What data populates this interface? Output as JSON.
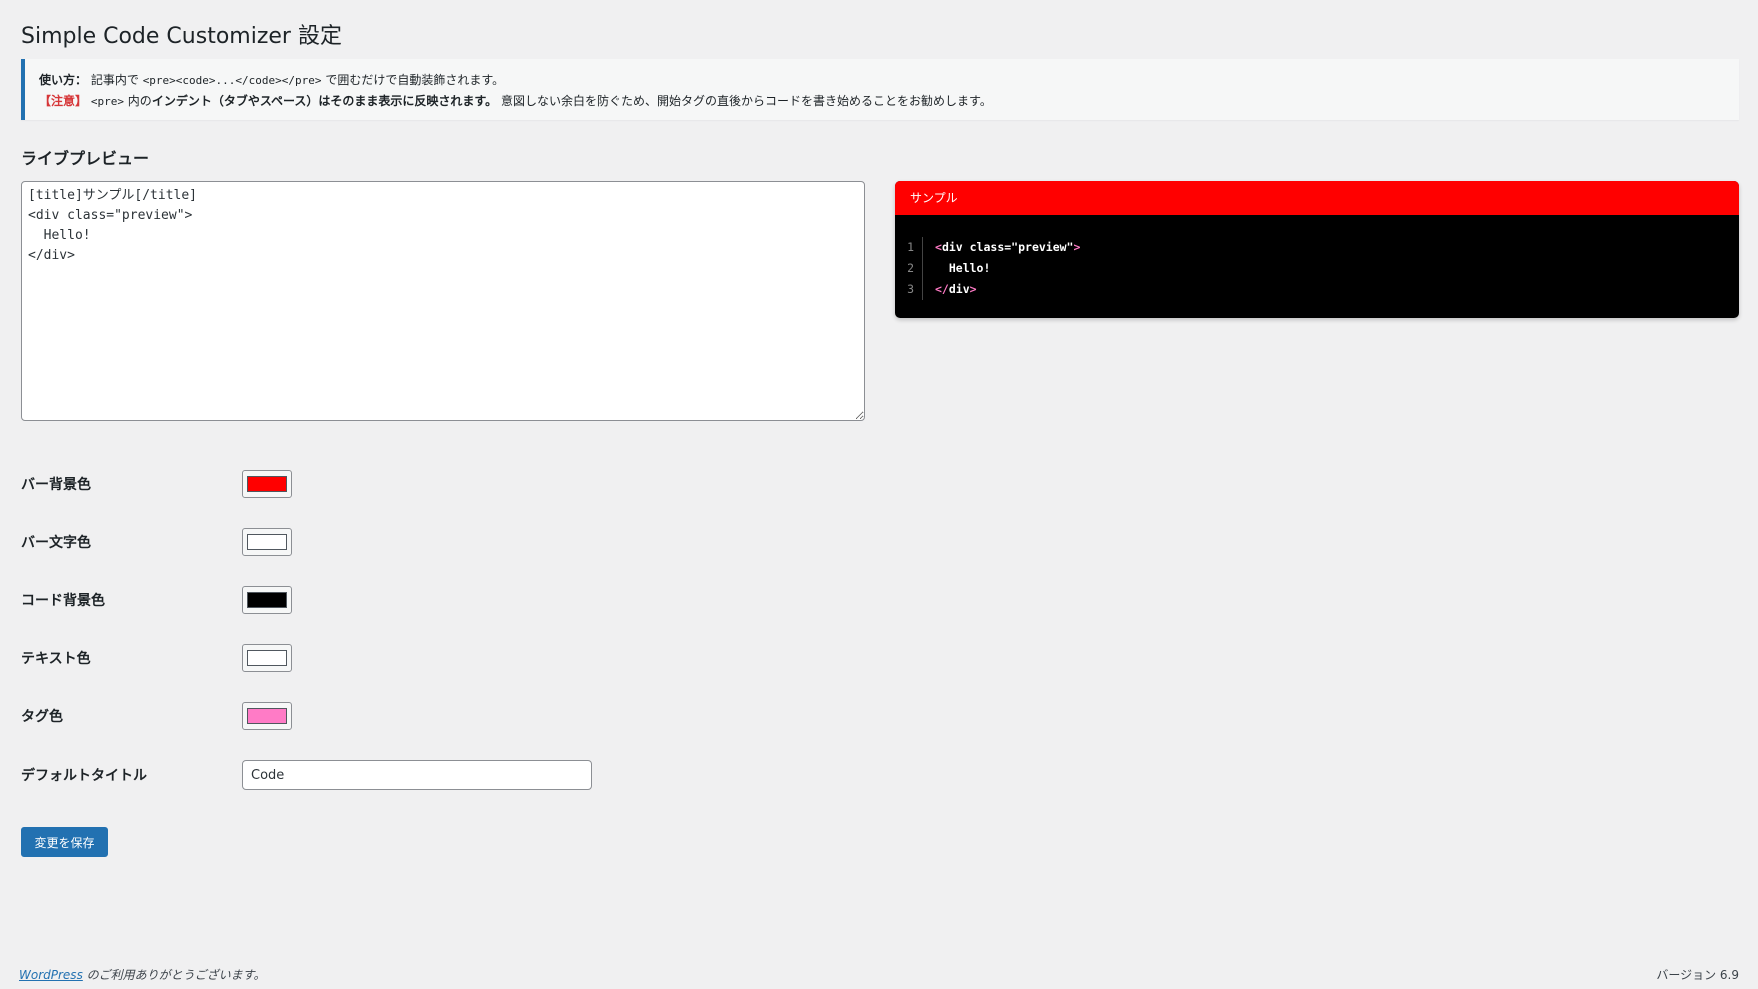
{
  "page": {
    "title": "Simple Code Customizer 設定"
  },
  "notice": {
    "usage_label": "使い方：",
    "usage_text_1": "記事内で",
    "usage_code": "<pre><code>...</code></pre>",
    "usage_text_2": "で囲むだけで自動装飾されます。",
    "warning_label": "【注意】",
    "warning_code": "<pre>",
    "warning_text_1": "内の",
    "warning_bold": "インデント（タブやスペース）はそのまま表示に反映されます。",
    "warning_text_2": "意図しない余白を防ぐため、開始タグの直後からコードを書き始めることをお勧めします。"
  },
  "preview": {
    "section_title": "ライブプレビュー",
    "editor_value": "[title]サンプル[/title]\n<div class=\"preview\">\n  Hello!\n</div>",
    "bar_title": "サンプル",
    "lines": [
      {
        "num": "1",
        "pre": "",
        "tag_open": "<",
        "body": "div class=\"preview\"",
        "tag_close": ">"
      },
      {
        "num": "2",
        "pre": "  ",
        "tag_open": "",
        "body": "Hello!",
        "tag_close": ""
      },
      {
        "num": "3",
        "pre": "",
        "tag_open": "</",
        "body": "div",
        "tag_close": ">"
      }
    ]
  },
  "settings": {
    "bar_bg": {
      "label": "バー背景色",
      "color": "#ff0000"
    },
    "bar_text": {
      "label": "バー文字色",
      "color": "#ffffff"
    },
    "code_bg": {
      "label": "コード背景色",
      "color": "#000000"
    },
    "text_color": {
      "label": "テキスト色",
      "color": "#ffffff"
    },
    "tag_color": {
      "label": "タグ色",
      "color": "#ff7bc6"
    },
    "default_title": {
      "label": "デフォルトタイトル",
      "value": "Code"
    }
  },
  "actions": {
    "save_label": "変更を保存"
  },
  "footer": {
    "wp_link": "WordPress",
    "thanks": " のご利用ありがとうございます。",
    "version": "バージョン 6.9"
  }
}
